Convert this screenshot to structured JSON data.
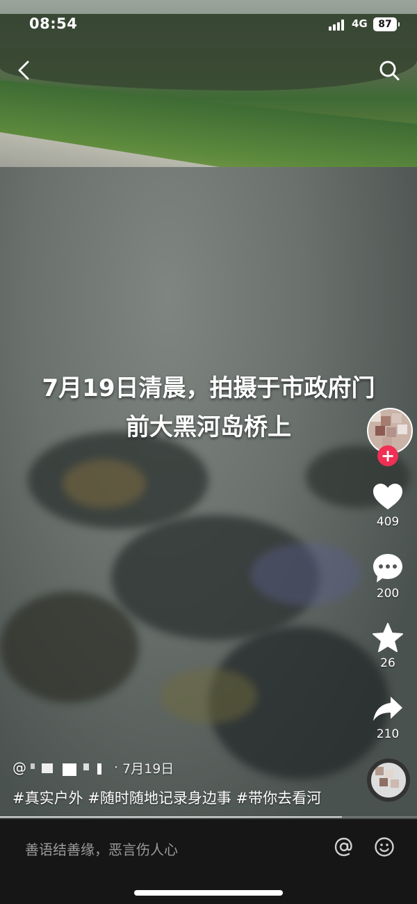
{
  "status": {
    "time": "08:54",
    "network": "4G",
    "battery": "87"
  },
  "video": {
    "caption_line1": "7月19日清晨，拍摄于市政府门",
    "caption_line2": "前大黑河岛桥上",
    "progress": 0.82
  },
  "nav": {
    "back_icon": "chevron-left-icon",
    "search_icon": "search-icon"
  },
  "actions": {
    "follow_label": "+",
    "like_count": "409",
    "comment_count": "200",
    "favorite_count": "26",
    "share_count": "210"
  },
  "post": {
    "author_prefix": "@",
    "date_separator": "·",
    "date": "7月19日",
    "tags": "#真实户外 #随时随地记录身边事 #带你去看河"
  },
  "bottom_bar": {
    "comment_placeholder": "善语结善缘，恶言伤人心"
  },
  "colors": {
    "follow": "#ef2f53",
    "bottom_bar": "#161616"
  }
}
